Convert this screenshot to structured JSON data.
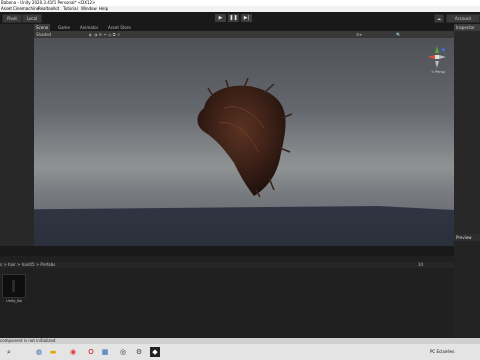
{
  "window": {
    "title": "Babona - Unity 2020.3.41f1 Personal* <DX12>"
  },
  "menu": [
    "Asset",
    "Cinemachine",
    "Realtoolkit",
    "Tutorial",
    "Window",
    "Help"
  ],
  "toolbar": {
    "pivot_label": "Pivot",
    "local_label": "Local",
    "account_label": "Account"
  },
  "scene_tabs": [
    "Scene",
    "Game",
    "Animator",
    "Asset Store"
  ],
  "scene": {
    "shaded_label": "Shaded",
    "gizmo_label": "< Persp"
  },
  "inspector": {
    "tab_label": "Inspector"
  },
  "preview": {
    "tab_label": "Preview"
  },
  "project": {
    "breadcrumb": [
      "s",
      "hair",
      "hair05",
      "Prefabs"
    ],
    "asset_name": "Unity_Ba",
    "asset_count": "14"
  },
  "status": {
    "message": "component is not initialized"
  },
  "taskbar": {
    "tray_text": "PC  Eclairées",
    "icons": [
      "edge-icon",
      "chrome-icon",
      "opera-icon",
      "store-icon",
      "explorer-icon",
      "steam-icon",
      "unity-icon"
    ]
  }
}
